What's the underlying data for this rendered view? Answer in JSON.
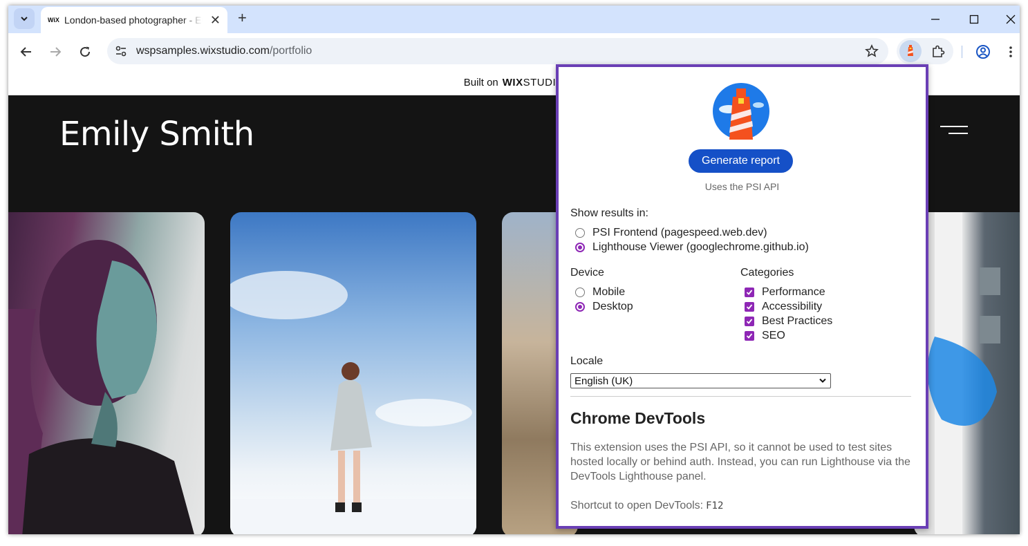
{
  "browser": {
    "tab_title": "London-based photographer - Emily Smith",
    "tab_favicon": "WiX",
    "url_host": "wspsamples.wixstudio.com",
    "url_path": "/portfolio"
  },
  "site": {
    "wix_banner_prefix": "Built on",
    "wix_brand": "WIX",
    "wix_brand_suffix": "STUDIO",
    "title": "Emily Smith"
  },
  "popup": {
    "generate_button": "Generate report",
    "psi_note": "Uses the PSI API",
    "show_results_label": "Show results in:",
    "results_options": [
      {
        "label": "PSI Frontend (pagespeed.web.dev)",
        "selected": false
      },
      {
        "label": "Lighthouse Viewer (googlechrome.github.io)",
        "selected": true
      }
    ],
    "device_label": "Device",
    "device_options": [
      {
        "label": "Mobile",
        "selected": false
      },
      {
        "label": "Desktop",
        "selected": true
      }
    ],
    "categories_label": "Categories",
    "categories": [
      {
        "label": "Performance",
        "checked": true
      },
      {
        "label": "Accessibility",
        "checked": true
      },
      {
        "label": "Best Practices",
        "checked": true
      },
      {
        "label": "SEO",
        "checked": true
      }
    ],
    "locale_label": "Locale",
    "locale_value": "English (UK)",
    "devtools_heading": "Chrome DevTools",
    "devtools_text": "This extension uses the PSI API, so it cannot be used to test sites hosted locally or behind auth. Instead, you can run Lighthouse via the DevTools Lighthouse panel.",
    "shortcut_text": "Shortcut to open DevTools:",
    "shortcut_key": "F12"
  },
  "colors": {
    "accent_purple": "#8e27b5",
    "popup_border": "#6a3fb5",
    "button_blue": "#1550c7"
  }
}
